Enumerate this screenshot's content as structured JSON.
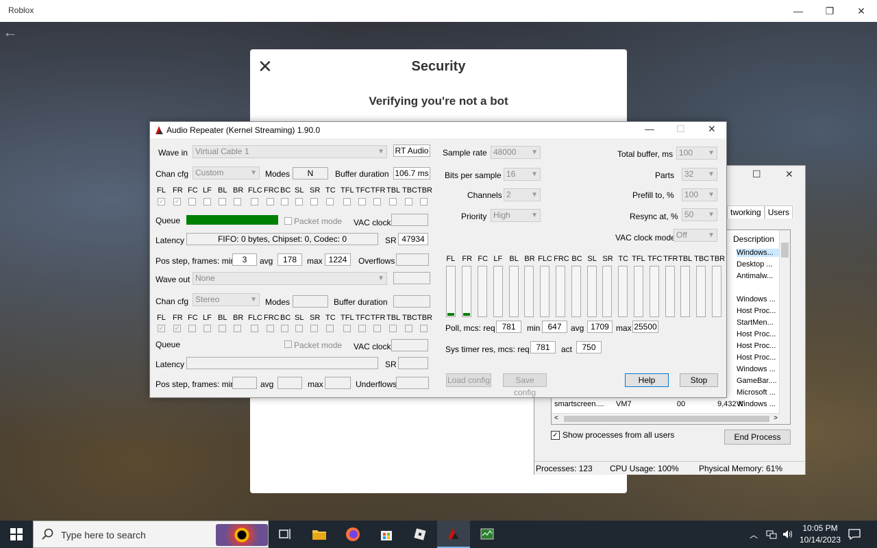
{
  "roblox": {
    "title": "Roblox"
  },
  "security": {
    "title": "Security",
    "subtitle": "Verifying you're not a bot"
  },
  "taskmgr": {
    "tabs": [
      "tworking",
      "Users"
    ],
    "desc_header": "Description",
    "descriptions": [
      "Windows...",
      "Desktop ...",
      "Antimalw...",
      "",
      "Windows ...",
      "Host Proc...",
      "StartMen...",
      "Host Proc...",
      "Host Proc...",
      "Host Proc...",
      "Windows ...",
      "GameBar....",
      "Microsoft ...",
      "Windows ..."
    ],
    "last_row": {
      "name": "smartscreen....",
      "user": "VM7",
      "cpu": "00",
      "mem": "9,432 K"
    },
    "show_all": "Show processes from all users",
    "end_process": "End Process",
    "status": {
      "processes": "Processes: 123",
      "cpu": "CPU Usage: 100%",
      "memory": "Physical Memory: 61%"
    }
  },
  "ar": {
    "title": "Audio Repeater (Kernel Streaming) 1.90.0",
    "labels": {
      "wave_in": "Wave in",
      "rt_audio": "RT Audio",
      "chan_cfg": "Chan cfg",
      "modes": "Modes",
      "buffer_duration": "Buffer duration",
      "queue": "Queue",
      "packet_mode": "Packet mode",
      "vac_clock": "VAC clock",
      "latency": "Latency",
      "sr": "SR",
      "pos_step": "Pos step, frames:  min",
      "avg": "avg",
      "max": "max",
      "overflows": "Overflows",
      "underflows": "Underflows",
      "wave_out": "Wave out",
      "sample_rate": "Sample rate",
      "bits_per_sample": "Bits per sample",
      "channels": "Channels",
      "priority": "Priority",
      "total_buffer": "Total buffer, ms",
      "parts": "Parts",
      "prefill": "Prefill to, %",
      "resync": "Resync at, %",
      "vac_clock_mode": "VAC clock mode",
      "poll": "Poll, mcs:  req",
      "min": "min",
      "sys_timer": "Sys timer res, mcs:  req",
      "act": "act",
      "load_config": "Load config",
      "save_config": "Save config",
      "help": "Help",
      "stop": "Stop"
    },
    "in": {
      "device": "Virtual Cable 1",
      "chan_cfg": "Custom",
      "modes": "N",
      "buffer_duration": "106.7 ms",
      "latency": "FIFO: 0 bytes, Chipset: 0, Codec: 0",
      "sr": "47934",
      "pos_min": "3",
      "pos_avg": "178",
      "pos_max": "1224",
      "queue_fill": 1.0
    },
    "out": {
      "device": "None",
      "chan_cfg": "Stereo"
    },
    "channels": [
      "FL",
      "FR",
      "FC",
      "LF",
      "BL",
      "BR",
      "FLC",
      "FRC",
      "BC",
      "SL",
      "SR",
      "TC",
      "TFL",
      "TFC",
      "TFR",
      "TBL",
      "TBC",
      "TBR"
    ],
    "in_checked": [
      true,
      true,
      false,
      false,
      false,
      false,
      false,
      false,
      false,
      false,
      false,
      false,
      false,
      false,
      false,
      false,
      false,
      false
    ],
    "out_checked": [
      true,
      true,
      false,
      false,
      false,
      false,
      false,
      false,
      false,
      false,
      false,
      false,
      false,
      false,
      false,
      false,
      false,
      false
    ],
    "meters": [
      0.06,
      0.06,
      0,
      0,
      0,
      0,
      0,
      0,
      0,
      0,
      0,
      0,
      0,
      0,
      0,
      0,
      0,
      0
    ],
    "params": {
      "sample_rate": "48000",
      "bits_per_sample": "16",
      "channels": "2",
      "priority": "High",
      "total_buffer": "100",
      "parts": "32",
      "prefill": "100",
      "resync": "50",
      "vac_clock_mode": "Off"
    },
    "poll": {
      "req": "781",
      "min": "647",
      "avg": "1709",
      "max": "25500"
    },
    "sys_timer": {
      "req": "781",
      "act": "750"
    }
  },
  "taskbar": {
    "search_placeholder": "Type here to search",
    "time": "10:05 PM",
    "date": "10/14/2023"
  }
}
